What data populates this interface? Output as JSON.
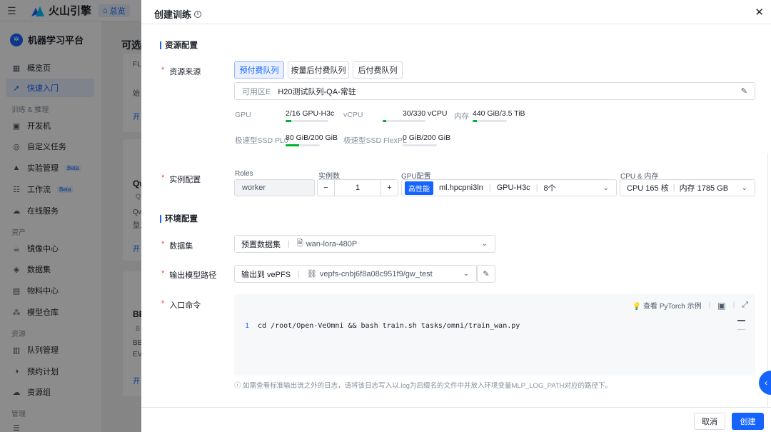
{
  "app": {
    "brand": "火山引擎",
    "home_chip": "总览",
    "platform_title": "机器学习平台",
    "page_heading_partial": "可选"
  },
  "sidebar": {
    "items": [
      {
        "label": "概览页",
        "icon": "dashboard-icon"
      },
      {
        "label": "快速入门",
        "icon": "rocket-icon",
        "active": true
      },
      {
        "label": "开发机",
        "icon": "terminal-icon"
      },
      {
        "label": "自定义任务",
        "icon": "custom-task-icon"
      },
      {
        "label": "实验管理",
        "icon": "flask-icon",
        "badge": "Beta"
      },
      {
        "label": "工作流",
        "icon": "workflow-icon",
        "badge": "Beta"
      },
      {
        "label": "在线服务",
        "icon": "cloud-icon"
      },
      {
        "label": "镜像中心",
        "icon": "image-icon"
      },
      {
        "label": "数据集",
        "icon": "dataset-icon"
      },
      {
        "label": "物料中心",
        "icon": "material-icon"
      },
      {
        "label": "模型仓库",
        "icon": "model-icon"
      },
      {
        "label": "队列管理",
        "icon": "queue-icon"
      },
      {
        "label": "预约计划",
        "icon": "schedule-icon"
      },
      {
        "label": "资源组",
        "icon": "resource-group-icon"
      }
    ],
    "groups": [
      "训练 & 推理",
      "资产",
      "资源",
      "管理"
    ]
  },
  "background_cards": [
    {
      "line1": "FL",
      "line2": "始",
      "action": "开"
    },
    {
      "line1": "Qw",
      "line2": "Q",
      "line3": "Qw",
      "line4": "型.",
      "action": "开"
    },
    {
      "line1": "BE",
      "line2": "B",
      "line3": "BE",
      "line4": "EV",
      "action": "开"
    }
  ],
  "drawer": {
    "title": "创建训练",
    "sections": {
      "resource": "资源配置",
      "env": "环境配置"
    },
    "resource_source": {
      "label": "资源来源",
      "options": [
        "预付费队列",
        "按量后付费队列",
        "后付费队列"
      ],
      "selected": "预付费队列",
      "zone_label": "可用区E",
      "queue_name": "H20测试队列-QA-常驻"
    },
    "stats": [
      {
        "label": "GPU",
        "value": "2/16 GPU-H3c",
        "ratio": 0.125
      },
      {
        "label": "vCPU",
        "value": "30/330 vCPU",
        "ratio": 0.09
      },
      {
        "label": "内存",
        "value": "440 GiB/3.5 TiB",
        "ratio": 0.12
      },
      {
        "label": "极速型SSD PL0",
        "value": "80 GiB/200 GiB",
        "ratio": 0.4
      },
      {
        "label": "极速型SSD FlexPL",
        "value": "0 GiB/200 GiB",
        "ratio": 0.0
      }
    ],
    "instance": {
      "label": "实例配置",
      "roles_label": "Roles",
      "role_value": "worker",
      "count_label": "实例数",
      "count_value": "1",
      "minus": "−",
      "plus": "+",
      "gpu_label": "GPU配置",
      "gpu_tag": "高性能",
      "gpu_spec": "ml.hpcpni3ln",
      "gpu_type": "GPU-H3c",
      "gpu_count": "8个",
      "cpu_mem_label": "CPU & 内存",
      "cpu": "CPU 165 核",
      "mem": "内存 1785 GB"
    },
    "dataset": {
      "label": "数据集",
      "type": "预置数据集",
      "value": "wan-lora-480P"
    },
    "output": {
      "label": "输出模型路径",
      "type": "输出到 vePFS",
      "value": "vepfs-cnbj6f8a08c951f9/gw_test"
    },
    "entry": {
      "label": "入口命令",
      "example_link": "查看 PyTorch 示例",
      "line_no": "1",
      "command": "cd /root/Open-VeOmni && bash train.sh tasks/omni/train_wan.py"
    },
    "hint": "ⓘ 如需查看标准输出流之外的日志，请将该日志写入以.log为后缀名的文件中并放入环境变量MLP_LOG_PATH对应的路径下。",
    "buttons": {
      "cancel": "取消",
      "create": "创建"
    }
  },
  "colors": {
    "accent": "#1664ff",
    "required": "#f53f3f",
    "usage_bar": "#00b42a"
  }
}
